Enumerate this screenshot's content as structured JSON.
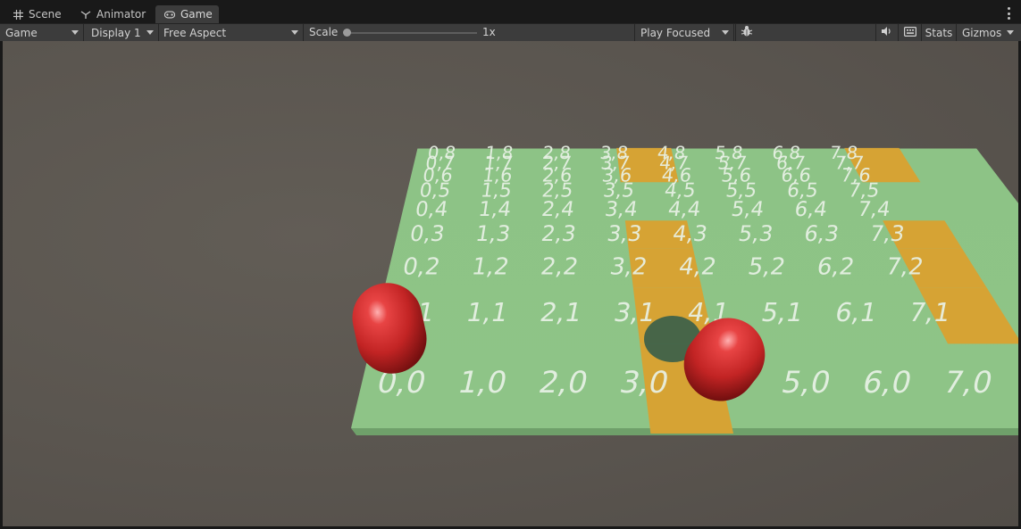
{
  "tabs": [
    {
      "label": "Scene",
      "icon": "grid-icon"
    },
    {
      "label": "Animator",
      "icon": "animator-icon"
    },
    {
      "label": "Game",
      "icon": "gamepad-icon",
      "active": true
    }
  ],
  "toolbar": {
    "view_select": "Game",
    "display_select": "Display 1",
    "aspect_select": "Free Aspect",
    "scale_label": "Scale",
    "scale_value": "1x",
    "play_mode_select": "Play Focused",
    "stats_label": "Stats",
    "gizmos_label": "Gizmos"
  },
  "scene": {
    "grid_columns": 8,
    "grid_rows": 9,
    "highlighted_cells": [
      "3,8",
      "3,7",
      "3,6",
      "3,3",
      "3,2",
      "3,1",
      "3,0",
      "7,8",
      "7,7",
      "7,6",
      "7,3",
      "7,2",
      "7,1"
    ],
    "colors": {
      "ground": "#8bc084",
      "ground_edge": "#6fa06a",
      "highlight": "#d6a334",
      "label": "#e8f1e6",
      "background": "#5a554f",
      "capsule": "#c22424",
      "capsule_shadow": "#2e5a4c"
    },
    "objects": [
      {
        "name": "red-capsule-left"
      },
      {
        "name": "red-capsule-right"
      }
    ]
  }
}
